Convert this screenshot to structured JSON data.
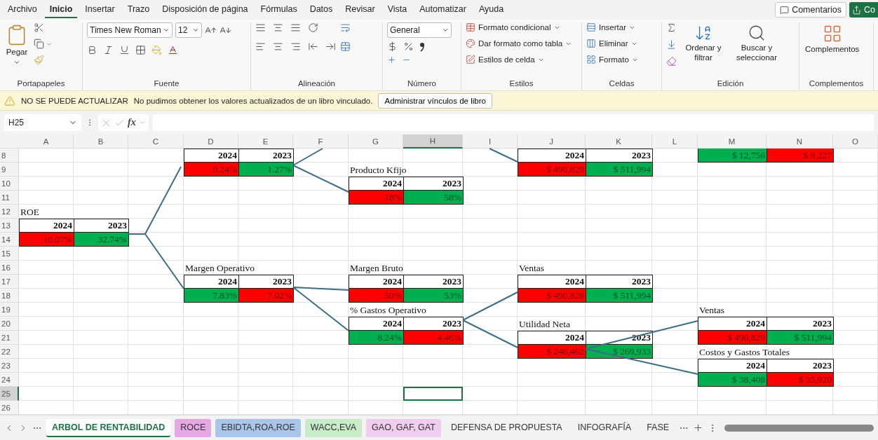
{
  "menu": {
    "tabs": [
      {
        "label": "Archivo",
        "selected": false
      },
      {
        "label": "Inicio",
        "selected": true
      },
      {
        "label": "Insertar",
        "selected": false
      },
      {
        "label": "Trazo",
        "selected": false
      },
      {
        "label": "Disposición de página",
        "selected": false
      },
      {
        "label": "Fórmulas",
        "selected": false
      },
      {
        "label": "Datos",
        "selected": false
      },
      {
        "label": "Revisar",
        "selected": false
      },
      {
        "label": "Vista",
        "selected": false
      },
      {
        "label": "Automatizar",
        "selected": false
      },
      {
        "label": "Ayuda",
        "selected": false
      }
    ],
    "comments_button": "Comentarios",
    "share_button": "Co"
  },
  "ribbon": {
    "clipboard": {
      "paste": "Pegar",
      "group_label": "Portapapeles"
    },
    "font": {
      "font_name": "Times New Roman",
      "font_size": "12",
      "group_label": "Fuente"
    },
    "alignment": {
      "group_label": "Alineación"
    },
    "number": {
      "format": "General",
      "group_label": "Número"
    },
    "styles": {
      "items": [
        "Formato condicional",
        "Dar formato como tabla",
        "Estilos de celda"
      ],
      "group_label": "Estilos"
    },
    "cells": {
      "items": [
        "Insertar",
        "Eliminar",
        "Formato"
      ],
      "group_label": "Celdas"
    },
    "editing": {
      "sort": "Ordenar y filtrar",
      "find": "Buscar y seleccionar",
      "group_label": "Edición"
    },
    "addins": {
      "button": "Complementos",
      "group_label": "Complementos"
    }
  },
  "message_bar": {
    "title": "NO SE PUEDE ACTUALIZAR",
    "text": "No pudimos obtener los valores actualizados de un libro vinculado.",
    "button": "Administrar vínculos de libro"
  },
  "formula_bar": {
    "name_box": "H25",
    "function_label": "fx"
  },
  "sheet": {
    "columns": [
      {
        "label": "A",
        "selected": false
      },
      {
        "label": "B",
        "selected": false
      },
      {
        "label": "C",
        "selected": false
      },
      {
        "label": "D",
        "selected": false
      },
      {
        "label": "E",
        "selected": false
      },
      {
        "label": "F",
        "selected": false
      },
      {
        "label": "G",
        "selected": false
      },
      {
        "label": "H",
        "selected": true
      },
      {
        "label": "I",
        "selected": false
      },
      {
        "label": "J",
        "selected": false
      },
      {
        "label": "K",
        "selected": false
      },
      {
        "label": "L",
        "selected": false
      },
      {
        "label": "M",
        "selected": false
      },
      {
        "label": "N",
        "selected": false
      },
      {
        "label": "O",
        "selected": false
      }
    ],
    "rows": [
      {
        "label": "8",
        "selected": false
      },
      {
        "label": "9",
        "selected": false
      },
      {
        "label": "10",
        "selected": false
      },
      {
        "label": "11",
        "selected": false
      },
      {
        "label": "12",
        "selected": false
      },
      {
        "label": "13",
        "selected": false
      },
      {
        "label": "14",
        "selected": false
      },
      {
        "label": "15",
        "selected": false
      },
      {
        "label": "16",
        "selected": false
      },
      {
        "label": "17",
        "selected": false
      },
      {
        "label": "18",
        "selected": false
      },
      {
        "label": "19",
        "selected": false
      },
      {
        "label": "20",
        "selected": false
      },
      {
        "label": "21",
        "selected": false
      },
      {
        "label": "22",
        "selected": false
      },
      {
        "label": "23",
        "selected": false
      },
      {
        "label": "24",
        "selected": false
      },
      {
        "label": "25",
        "selected": true
      },
      {
        "label": "26",
        "selected": false
      }
    ],
    "blocks": [
      {
        "label": "ROE",
        "header": [
          "2024",
          "2023"
        ],
        "values": [
          {
            "text": "10.07%",
            "color": "#ff0000"
          },
          {
            "text": "32.74%",
            "color": "#00b050"
          }
        ]
      },
      {
        "header": [
          "2024",
          "2023"
        ],
        "values": [
          {
            "text": "0.24%",
            "color": "#ff0000"
          },
          {
            "text": "1.27%",
            "color": "#00b050"
          }
        ]
      },
      {
        "label": "Producto Kfijo",
        "header": [
          "2024",
          "2023"
        ],
        "values": [
          {
            "text": "18%",
            "color": "#ff0000"
          },
          {
            "text": "58%",
            "color": "#00b050"
          }
        ]
      },
      {
        "header": [
          "2024",
          "2023"
        ],
        "values": [
          {
            "text": "$ 490,829",
            "color": "#ff0000"
          },
          {
            "text": "$ 511,994",
            "color": "#00b050"
          }
        ]
      },
      {
        "values": [
          {
            "text": "$ 12,756",
            "color": "#00b050"
          },
          {
            "text": "$ 9,227",
            "color": "#ff0000"
          }
        ]
      },
      {
        "label": "Margen Operativo",
        "header": [
          "2024",
          "2023"
        ],
        "values": [
          {
            "text": "7.83%",
            "color": "#00b050"
          },
          {
            "text": "7.02%",
            "color": "#ff0000"
          }
        ]
      },
      {
        "label": "Margen Bruto",
        "header": [
          "2024",
          "2023"
        ],
        "values": [
          {
            "text": "50%",
            "color": "#ff0000"
          },
          {
            "text": "53%",
            "color": "#00b050"
          }
        ]
      },
      {
        "label": "% Gastos Operativo",
        "header": [
          "2024",
          "2023"
        ],
        "values": [
          {
            "text": "8.24%",
            "color": "#00b050"
          },
          {
            "text": "4.46%",
            "color": "#ff0000"
          }
        ]
      },
      {
        "label": "Ventas",
        "header": [
          "2024",
          "2023"
        ],
        "values": [
          {
            "text": "$ 490,829",
            "color": "#ff0000"
          },
          {
            "text": "$ 511,994",
            "color": "#00b050"
          }
        ]
      },
      {
        "label": "Utilidad Neta",
        "header": [
          "2024",
          "2023"
        ],
        "values": [
          {
            "text": "$ 246,462",
            "color": "#ff0000"
          },
          {
            "text": "$ 269,933",
            "color": "#00b050"
          }
        ]
      },
      {
        "label": "Ventas",
        "header": [
          "2024",
          "2023"
        ],
        "values": [
          {
            "text": "$ 490,829",
            "color": "#ff0000"
          },
          {
            "text": "$ 511,994",
            "color": "#00b050"
          }
        ]
      },
      {
        "label": "Costos y Gastos Totales",
        "header": [
          "2024",
          "2023"
        ],
        "values": [
          {
            "text": "$ 38,408",
            "color": "#00b050"
          },
          {
            "text": "$ 35,920",
            "color": "#ff0000"
          }
        ]
      }
    ]
  },
  "sheet_tabs": [
    {
      "label": "ARBOL DE RENTABILIDAD",
      "selected": true
    },
    {
      "label": "ROCE",
      "selected": false,
      "color": "#e6a8e2"
    },
    {
      "label": "EBIDTA,ROA,ROE",
      "selected": false,
      "color": "#a9c6ea"
    },
    {
      "label": "WACC,EVA",
      "selected": false,
      "color": "#c8ecc8"
    },
    {
      "label": "GAO, GAF, GAT",
      "selected": false,
      "color": "#efcdef"
    },
    {
      "label": "DEFENSA DE PROPUESTA",
      "selected": false
    },
    {
      "label": "INFOGRAFÍA",
      "selected": false
    },
    {
      "label": "FASE",
      "selected": false
    }
  ]
}
